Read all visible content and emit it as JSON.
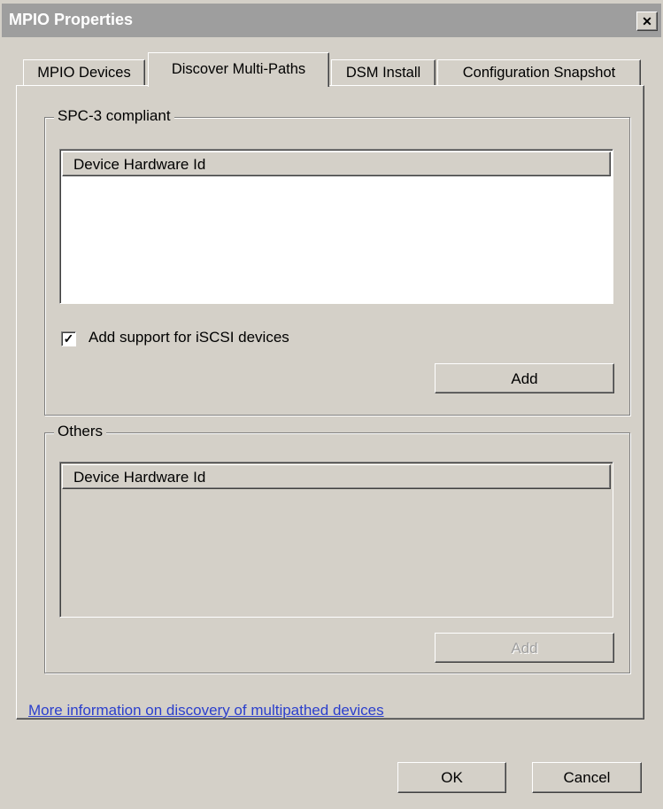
{
  "window": {
    "title": "MPIO Properties",
    "close_glyph": "✕"
  },
  "tabs": [
    {
      "label": "MPIO Devices",
      "active": false
    },
    {
      "label": "Discover Multi-Paths",
      "active": true
    },
    {
      "label": "DSM Install",
      "active": false
    },
    {
      "label": "Configuration Snapshot",
      "active": false
    }
  ],
  "spc3": {
    "group_label": "SPC-3 compliant",
    "column_header": "Device Hardware Id",
    "iscsi_label": "Add support for iSCSI devices",
    "iscsi_checked": true,
    "check_glyph": "✓",
    "add_label": "Add"
  },
  "others": {
    "group_label": "Others",
    "column_header": "Device Hardware Id",
    "add_label": "Add",
    "add_disabled": true
  },
  "link_text": "More information on discovery of multipathed devices",
  "footer": {
    "ok_label": "OK",
    "cancel_label": "Cancel"
  },
  "colors": {
    "title_bar": "#9e9e9e",
    "face": "#d4d0c8",
    "link": "#2b3fcc"
  }
}
